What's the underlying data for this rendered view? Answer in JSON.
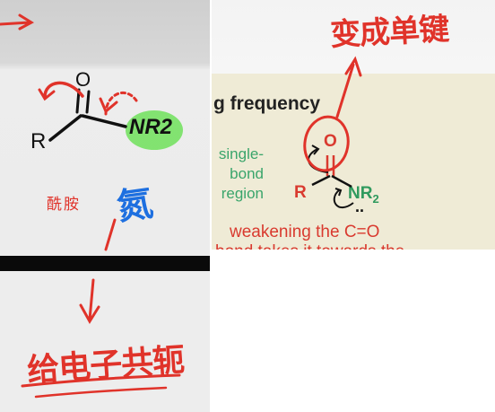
{
  "left_panel": {
    "structure": {
      "atom_o": "O",
      "atom_r": "R",
      "group_nr2": "NR2"
    },
    "amide_label": "酰胺",
    "handwritten_blue": "氮",
    "handwritten_bottom": "给电子共轭"
  },
  "right_panel": {
    "handwritten_top": "变成单键",
    "heading": "g frequency",
    "region_labels": [
      "single-",
      "bond",
      "region"
    ],
    "structure": {
      "atom_o": "O",
      "atom_r": "R",
      "group_nr2_main": "NR",
      "group_nr2_sub": "2",
      "lone_pair": ".."
    },
    "caption_line1": "weakening the C=O",
    "caption_line2": "bond takes it towards the"
  },
  "colors": {
    "ink_red": "#e0332a",
    "ink_blue": "#1d6fe0",
    "highlight_green": "#6ee05a",
    "text_green": "#3aa56b",
    "text_red": "#d93a2f",
    "page_cream": "#efebd6"
  }
}
